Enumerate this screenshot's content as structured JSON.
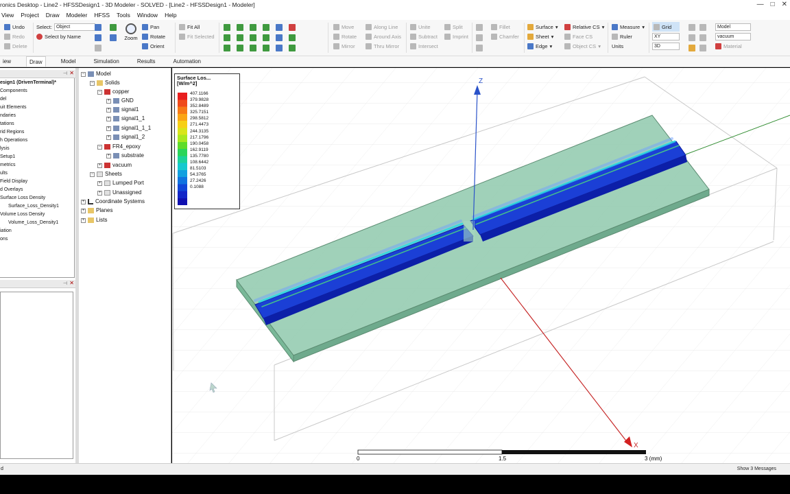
{
  "window": {
    "title": "ronics Desktop - Line2 - HFSSDesign1 - 3D Modeler - SOLVED - [Line2 - HFSSDesign1 - Modeler]",
    "controls": [
      "—",
      "□",
      "✕"
    ]
  },
  "menu": [
    "View",
    "Project",
    "Draw",
    "Modeler",
    "HFSS",
    "Tools",
    "Window",
    "Help"
  ],
  "ribbon": {
    "undo": "Undo",
    "redo": "Redo",
    "delete": "Delete",
    "select_label": "Select:",
    "select_value": "Object",
    "select_by_name": "Select by Name",
    "zoom": "Zoom",
    "pan": "Pan",
    "rotate": "Rotate",
    "orient": "Orient",
    "fit_all": "Fit All",
    "fit_selected": "Fit Selected",
    "move": "Move",
    "rotate2": "Rotate",
    "mirror": "Mirror",
    "along_line": "Along Line",
    "around_axis": "Around Axis",
    "thru_mirror": "Thru Mirror",
    "unite": "Unite",
    "subtract": "Subtract",
    "intersect": "Intersect",
    "split": "Split",
    "imprint": "Imprint",
    "fillet": "Fillet",
    "chamfer": "Chamfer",
    "surface": "Surface",
    "sheet": "Sheet",
    "edge": "Edge",
    "relative_cs": "Relative CS",
    "face_cs": "Face CS",
    "object_cs": "Object CS",
    "measure": "Measure",
    "ruler": "Ruler",
    "units": "Units",
    "grid": "Grid",
    "plane": "XY",
    "view_mode": "3D",
    "model_sel": "Model",
    "material_sel": "vacuum",
    "material": "Material"
  },
  "tabs": [
    "iew",
    "Draw",
    "Model",
    "Simulation",
    "Results",
    "Automation"
  ],
  "active_tab": "Draw",
  "project_tree": [
    "esign1 (DrivenTerminal)*",
    "Components",
    "del",
    "uit Elements",
    "ndaries",
    "tations",
    "rid Regions",
    "h Operations",
    "lysis",
    "Setup1",
    "metrics",
    "ults",
    "Field Display",
    "d Overlays",
    "Surface Loss Density",
    "Surface_Loss_Density1",
    "Volume Loss Density",
    "Volume_Loss_Density1",
    "iation",
    "ons"
  ],
  "model_tree": {
    "model": "Model",
    "solids": "Solids",
    "copper": "copper",
    "gnd": "GND",
    "signal1": "signal1",
    "signal1_1": "signal1_1",
    "signal1_1_1": "signal1_1_1",
    "signal1_2": "signal1_2",
    "fr4": "FR4_epoxy",
    "substrate": "substrate",
    "vacuum": "vacuum",
    "sheets": "Sheets",
    "lumped_port": "Lumped Port",
    "unassigned": "Unassigned",
    "coord": "Coordinate Systems",
    "planes": "Planes",
    "lists": "Lists"
  },
  "legend": {
    "title": "Surface Los...",
    "unit": "[W/m^2]",
    "values": [
      "407.1166",
      "379.9828",
      "352.8489",
      "325.7151",
      "298.5812",
      "271.4473",
      "244.3135",
      "217.1796",
      "190.0458",
      "162.9119",
      "135.7780",
      "108.6442",
      "81.5103",
      "54.3765",
      "27.2426",
      "0.1088"
    ],
    "colors": [
      "#e81e1e",
      "#f04a1a",
      "#f77a16",
      "#fba515",
      "#f7cf15",
      "#d9e51a",
      "#a9e81f",
      "#5fdc2a",
      "#2ad55a",
      "#1bd39a",
      "#14c9cf",
      "#12a0e0",
      "#1173e0",
      "#1146d8",
      "#1226c8",
      "#1010b0"
    ]
  },
  "axes": {
    "x": "X",
    "z": "Z"
  },
  "scale": {
    "left": "0",
    "mid": "1.5",
    "right": "3 (mm)"
  },
  "status": {
    "left": "d",
    "messages": "Show 3 Messages"
  }
}
